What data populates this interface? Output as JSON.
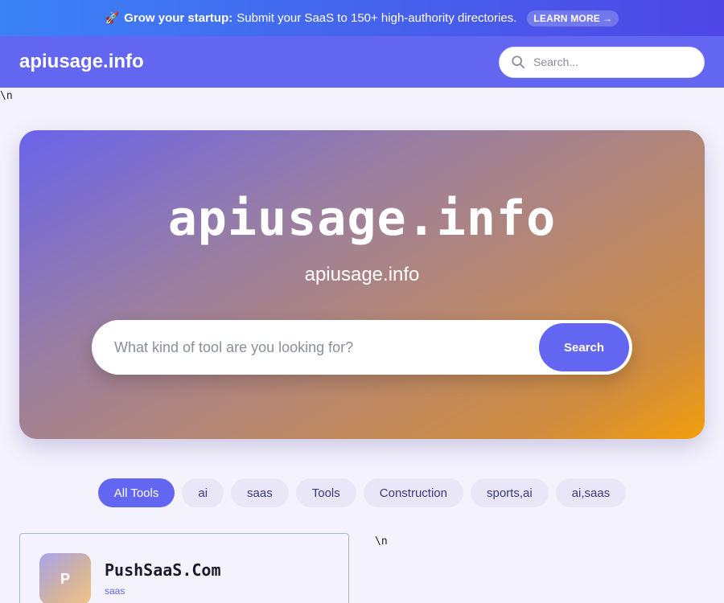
{
  "promo": {
    "rocket": "🚀",
    "strong": "Grow your startup:",
    "text": "Submit your SaaS to 150+ high-authority directories.",
    "cta": "LEARN MORE",
    "cta_arrow": "→"
  },
  "header": {
    "logo": "apiusage.info",
    "search_placeholder": "Search..."
  },
  "stray_text": "\\n",
  "hero": {
    "title": "apiusage.info",
    "subtitle": "apiusage.info",
    "search_placeholder": "What kind of tool are you looking for?",
    "search_button": "Search"
  },
  "filters": [
    {
      "label": "All Tools",
      "active": true
    },
    {
      "label": "ai",
      "active": false
    },
    {
      "label": "saas",
      "active": false
    },
    {
      "label": "Tools",
      "active": false
    },
    {
      "label": "Construction",
      "active": false
    },
    {
      "label": "sports,ai",
      "active": false
    },
    {
      "label": "ai,saas",
      "active": false
    }
  ],
  "tools": [
    {
      "initial": "P",
      "name": "PushSaaS.Com",
      "tag": "saas"
    }
  ],
  "colors": {
    "accent": "#6366f1",
    "hero_gradient_start": "#6a63ec",
    "hero_gradient_end": "#f29e0b"
  }
}
